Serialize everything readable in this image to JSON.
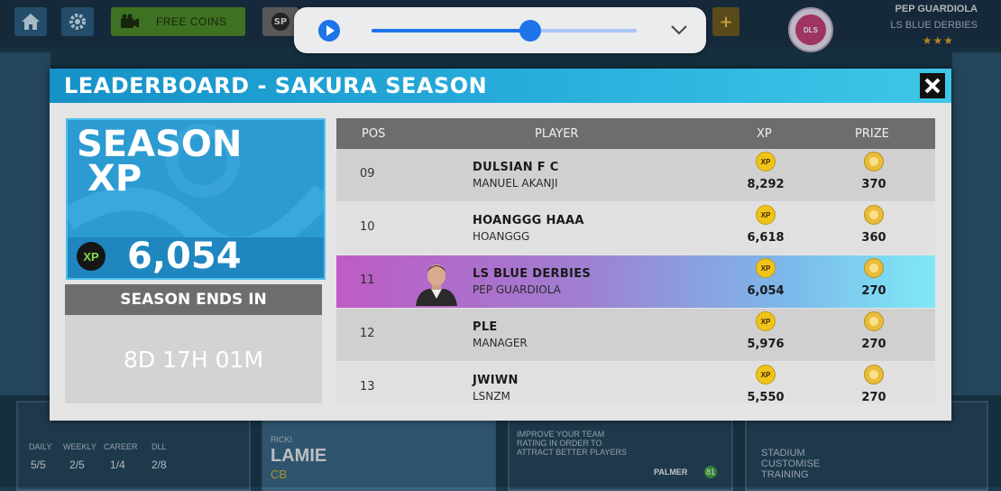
{
  "hud": {
    "free_coins_label": "FREE COINS",
    "sp_badge": "SP",
    "plus_label": "+",
    "club_badge_text": "DLS",
    "manager_name": "PEP GUARDIOLA",
    "club_name": "LS BLUE DERBIES",
    "stars": "★★★"
  },
  "media": {
    "progress": 0.6
  },
  "background": {
    "daily_label": "DAILY",
    "weekly_label": "WEEKLY",
    "career_label": "CAREER",
    "dll_label": "DLL",
    "daily_value": "5/5",
    "weekly_value": "2/5",
    "career_value": "1/4",
    "dll_value": "2/8",
    "player_first": "RICKI",
    "player_last": "LAMIE",
    "player_pos": "CB",
    "improve_text": "IMPROVE YOUR TEAM RATING IN ORDER TO ATTRACT BETTER PLAYERS",
    "palmer_label": "PALMER",
    "palmer_rating": "81",
    "stadium_text": "STADIUM CUSTOMISE TRAINING"
  },
  "modal": {
    "title": "LEADERBOARD - SAKURA SEASON",
    "season_line1": "SEASON",
    "season_line2": "XP",
    "xp_badge": "XP",
    "season_xp": "6,054",
    "ends_label": "SEASON ENDS IN",
    "ends_value": "8D 17H 01M"
  },
  "table": {
    "headers": {
      "pos": "POS",
      "player": "PLAYER",
      "xp": "XP",
      "prize": "PRIZE"
    },
    "xp_badge": "XP",
    "rows": [
      {
        "pos": "09",
        "team": "DULSIAN F C",
        "user": "MANUEL AKANJI",
        "xp": "8,292",
        "prize": "370"
      },
      {
        "pos": "10",
        "team": "HOANGGG HAAA",
        "user": "HOANGGG",
        "xp": "6,618",
        "prize": "360"
      },
      {
        "pos": "11",
        "team": "LS BLUE DERBIES",
        "user": "PEP GUARDIOLA",
        "xp": "6,054",
        "prize": "270"
      },
      {
        "pos": "12",
        "team": "PLE",
        "user": "MANAGER",
        "xp": "5,976",
        "prize": "270"
      },
      {
        "pos": "13",
        "team": "JWIWN",
        "user": "LSNZM",
        "xp": "5,550",
        "prize": "270"
      }
    ]
  },
  "colors": {
    "header_gradient_start": "#1591c7",
    "highlight_row_start": "#bf5bc6",
    "highlight_row_end": "#7fe9f6",
    "xp_coin": "#f0c31b"
  }
}
